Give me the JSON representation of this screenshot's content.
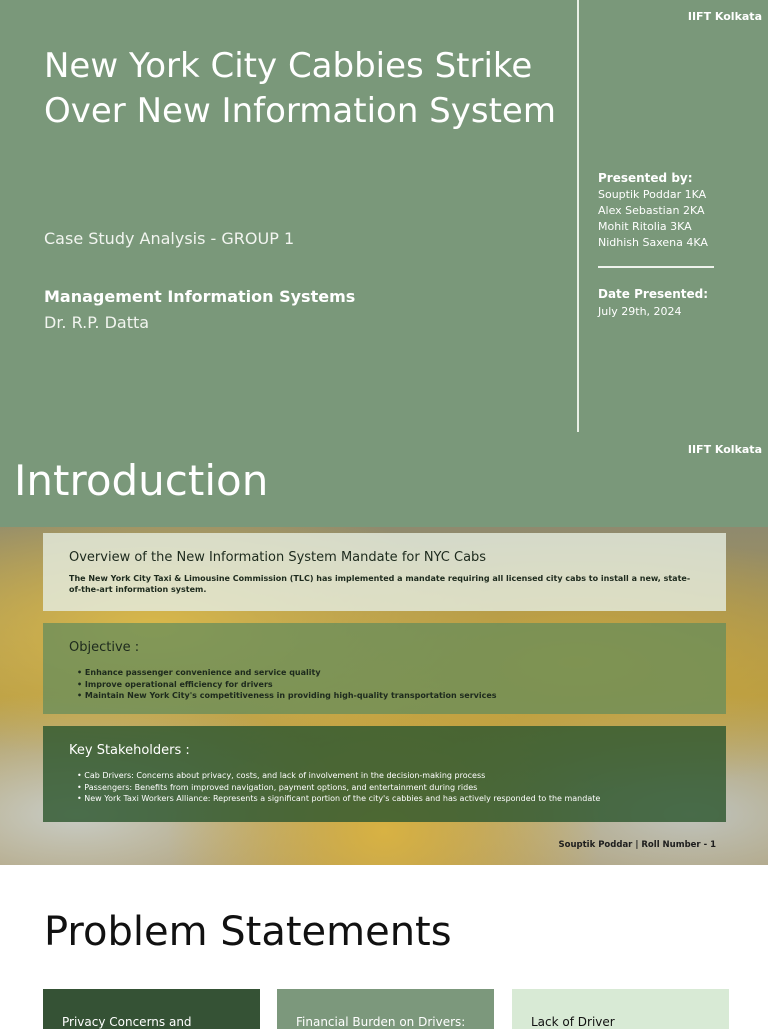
{
  "slide1": {
    "tag": "IIFT Kolkata",
    "title": "New York City Cabbies Strike Over New Information System",
    "subtitle": "Case Study Analysis - GROUP 1",
    "course": "Management Information Systems",
    "professor": "Dr. R.P. Datta",
    "presented_by_label": "Presented by:",
    "presenters": [
      "Souptik Poddar 1KA",
      "Alex Sebastian 2KA",
      "Mohit Ritolia 3KA",
      "Nidhish Saxena 4KA"
    ],
    "date_label": "Date Presented:",
    "date": "July 29th, 2024"
  },
  "slide2": {
    "tag": "IIFT Kolkata",
    "title": "Introduction",
    "overview": {
      "heading": "Overview of the New Information System Mandate for NYC Cabs",
      "text": "The New York City Taxi & Limousine Commission (TLC) has implemented a mandate requiring all licensed city cabs to install a new, state-of-the-art information system."
    },
    "objective": {
      "heading": "Objective :",
      "items": [
        "Enhance passenger convenience and service quality",
        "Improve operational efficiency for drivers",
        "Maintain New York City's competitiveness in providing high-quality transportation services"
      ]
    },
    "stakeholders": {
      "heading": "Key Stakeholders :",
      "items": [
        "Cab Drivers: Concerns about privacy, costs, and lack of involvement in the decision-making process",
        "Passengers: Benefits from improved navigation, payment options, and entertainment during rides",
        "New York Taxi Workers Alliance: Represents a significant portion of the city's cabbies and has actively responded to the mandate"
      ]
    },
    "footer": "Souptik Poddar | Roll Number - 1"
  },
  "slide3": {
    "title": "Problem Statements",
    "cards": [
      "Privacy Concerns and",
      "Financial Burden on Drivers:",
      "Lack of Driver"
    ]
  }
}
